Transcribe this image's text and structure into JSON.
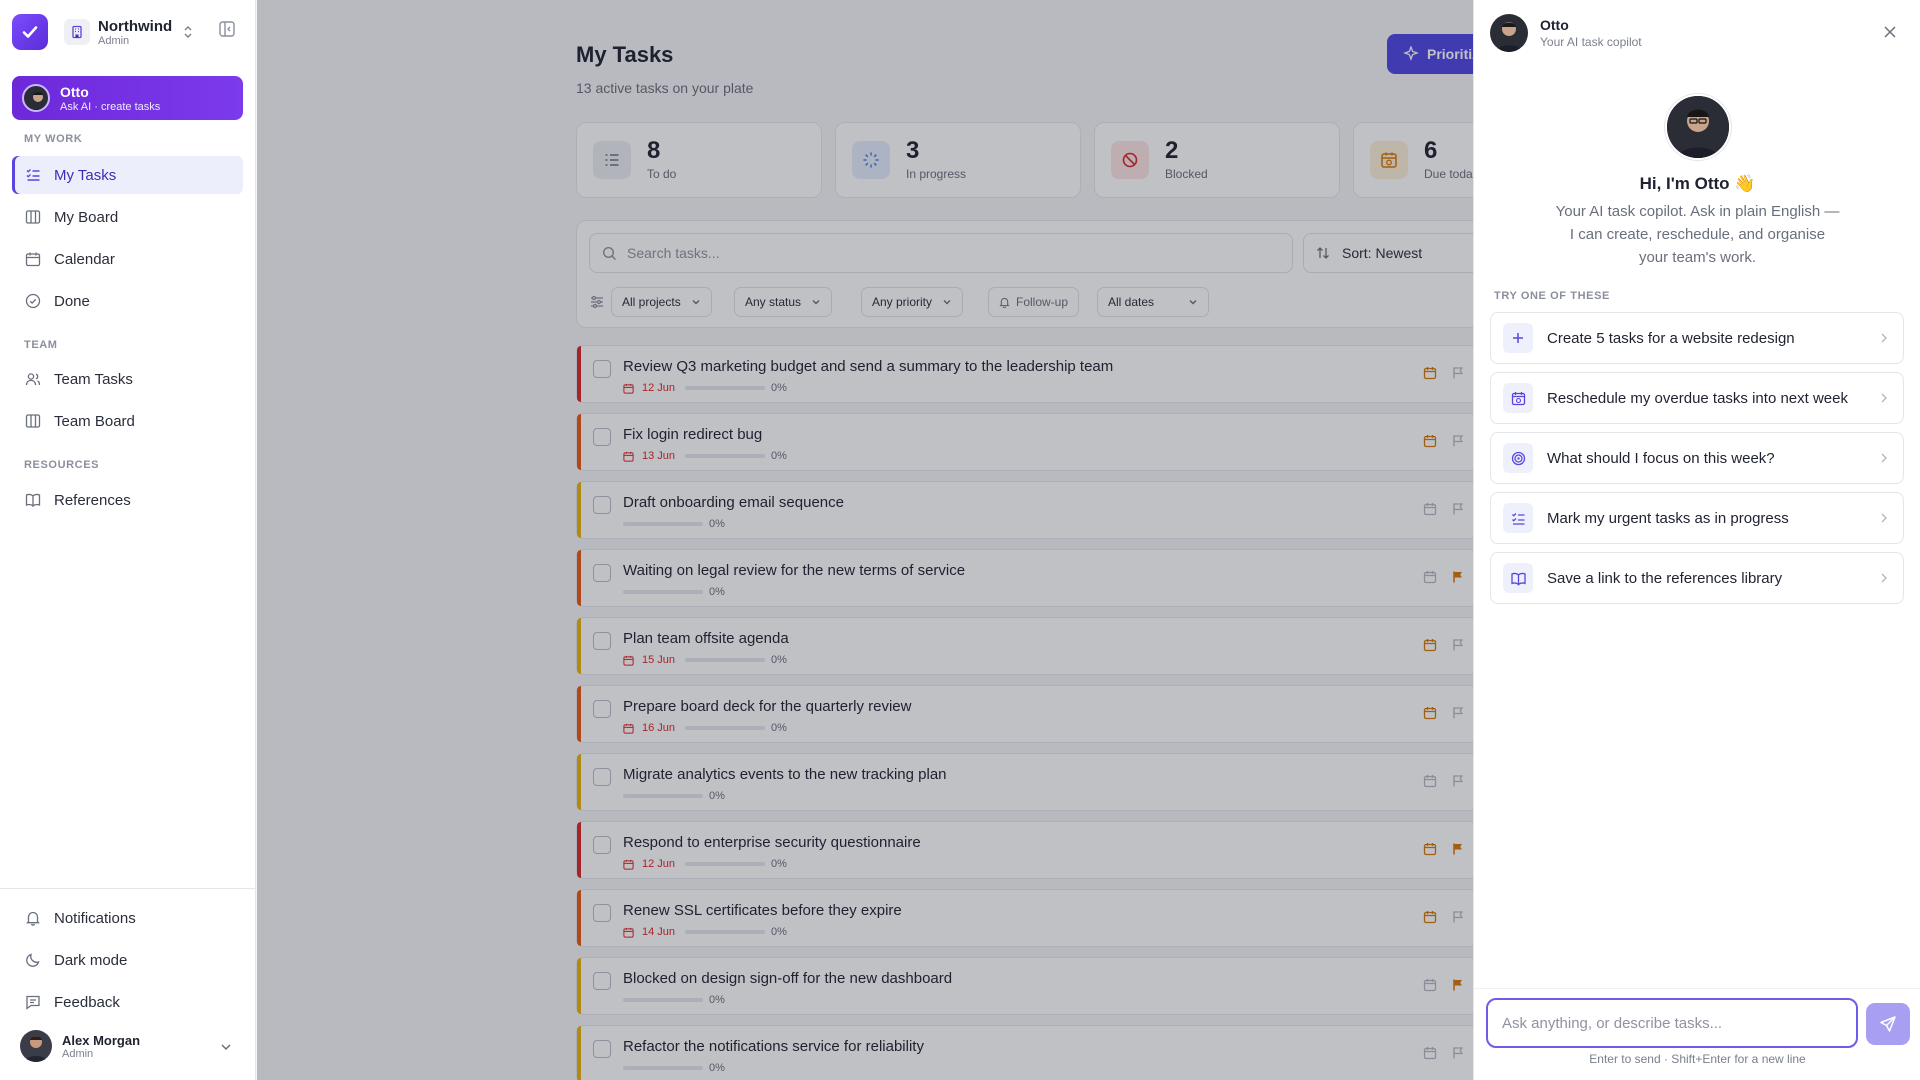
{
  "workspace": {
    "name": "Northwind",
    "role": "Admin"
  },
  "otto_card": {
    "name": "Otto",
    "subtitle": "Ask AI · create tasks"
  },
  "sidebar": {
    "my_work_label": "MY WORK",
    "my_work": [
      {
        "label": "My Tasks",
        "icon": "list-check-icon",
        "active": true
      },
      {
        "label": "My Board",
        "icon": "board-icon"
      },
      {
        "label": "Calendar",
        "icon": "calendar-icon"
      },
      {
        "label": "Done",
        "icon": "check-circle-icon"
      }
    ],
    "team_label": "TEAM",
    "team": [
      {
        "label": "Team Tasks",
        "icon": "users-icon"
      },
      {
        "label": "Team Board",
        "icon": "board-icon"
      }
    ],
    "resources_label": "RESOURCES",
    "resources": [
      {
        "label": "References",
        "icon": "book-icon"
      }
    ],
    "bottom": [
      {
        "label": "Notifications",
        "icon": "bell-icon"
      },
      {
        "label": "Dark mode",
        "icon": "moon-icon"
      },
      {
        "label": "Feedback",
        "icon": "feedback-icon"
      }
    ]
  },
  "user": {
    "name": "Alex Morgan",
    "role": "Admin"
  },
  "main": {
    "title": "My Tasks",
    "subtitle": "13 active tasks on your plate",
    "prioritize_label": "Prioritize"
  },
  "stats": [
    {
      "value": "8",
      "label": "To do",
      "color": "#6b7280",
      "bg": "#eceef3"
    },
    {
      "value": "3",
      "label": "In progress",
      "color": "#4f7bd6",
      "bg": "#e4ecfb"
    },
    {
      "value": "2",
      "label": "Blocked",
      "color": "#dc2626",
      "bg": "#fde4e4"
    },
    {
      "value": "6",
      "label": "Due today",
      "color": "#d97706",
      "bg": "#fdf0d9"
    }
  ],
  "filters": {
    "search_placeholder": "Search tasks...",
    "sort_label": "Sort: Newest",
    "chips": [
      "All projects",
      "Any status",
      "Any priority",
      "Follow-up",
      "All dates"
    ]
  },
  "tasks": [
    {
      "title": "Review Q3 marketing budget and send a summary to the leadership team",
      "due": "12 Jun",
      "progress": "0%",
      "bar": "#dc2626",
      "flag": false,
      "cal_active": true
    },
    {
      "title": "Fix login redirect bug",
      "due": "13 Jun",
      "progress": "0%",
      "bar": "#ea580c",
      "flag": false,
      "cal_active": true
    },
    {
      "title": "Draft onboarding email sequence",
      "due": "",
      "progress": "0%",
      "bar": "#eab308",
      "flag": false,
      "cal_active": false
    },
    {
      "title": "Waiting on legal review for the new terms of service",
      "due": "",
      "progress": "0%",
      "bar": "#ea580c",
      "flag": true,
      "cal_active": false
    },
    {
      "title": "Plan team offsite agenda",
      "due": "15 Jun",
      "progress": "0%",
      "bar": "#eab308",
      "flag": false,
      "cal_active": true
    },
    {
      "title": "Prepare board deck for the quarterly review",
      "due": "16 Jun",
      "progress": "0%",
      "bar": "#ea580c",
      "flag": false,
      "cal_active": true
    },
    {
      "title": "Migrate analytics events to the new tracking plan",
      "due": "",
      "progress": "0%",
      "bar": "#eab308",
      "flag": false,
      "cal_active": false
    },
    {
      "title": "Respond to enterprise security questionnaire",
      "due": "12 Jun",
      "progress": "0%",
      "bar": "#dc2626",
      "flag": true,
      "cal_active": true
    },
    {
      "title": "Renew SSL certificates before they expire",
      "due": "14 Jun",
      "progress": "0%",
      "bar": "#ea580c",
      "flag": false,
      "cal_active": true
    },
    {
      "title": "Blocked on design sign-off for the new dashboard",
      "due": "",
      "progress": "0%",
      "bar": "#eab308",
      "flag": true,
      "cal_active": false
    },
    {
      "title": "Refactor the notifications service for reliability",
      "due": "",
      "progress": "0%",
      "bar": "#eab308",
      "flag": false,
      "cal_active": false
    }
  ],
  "panel": {
    "name": "Otto",
    "subtitle": "Your AI task copilot",
    "greeting": "Hi, I'm Otto 👋",
    "intro": "Your AI task copilot. Ask in plain English — I can create, reschedule, and organise your team's work.",
    "try_label": "TRY ONE OF THESE",
    "suggestions": [
      {
        "label": "Create 5 tasks for a website redesign",
        "icon": "plus-icon"
      },
      {
        "label": "Reschedule my overdue tasks into next week",
        "icon": "calendar-clock-icon"
      },
      {
        "label": "What should I focus on this week?",
        "icon": "target-icon"
      },
      {
        "label": "Mark my urgent tasks as in progress",
        "icon": "list-check-icon"
      },
      {
        "label": "Save a link to the references library",
        "icon": "book-icon"
      }
    ],
    "composer_placeholder": "Ask anything, or describe tasks...",
    "hint": "Enter to send · Shift+Enter for a new line"
  },
  "colors": {
    "accent": "#4f46e5",
    "otto_gradient_start": "#6d28d9",
    "otto_gradient_end": "#7c3aed"
  }
}
